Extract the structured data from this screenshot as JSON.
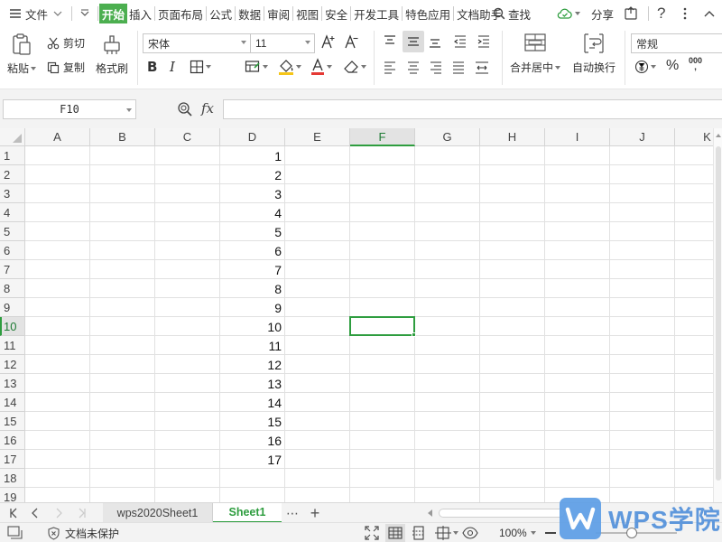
{
  "menubar": {
    "file_label": "文件",
    "tabs": [
      {
        "label": "开始",
        "active": true
      },
      {
        "label": "插入"
      },
      {
        "label": "页面布局"
      },
      {
        "label": "公式"
      },
      {
        "label": "数据"
      },
      {
        "label": "审阅"
      },
      {
        "label": "视图"
      },
      {
        "label": "安全"
      },
      {
        "label": "开发工具"
      },
      {
        "label": "特色应用"
      },
      {
        "label": "文档助手"
      }
    ],
    "search_label": "查找",
    "share_label": "分享"
  },
  "ribbon": {
    "paste_label": "粘贴",
    "cut_label": "剪切",
    "copy_label": "复制",
    "format_painter_label": "格式刷",
    "font_name": "宋体",
    "font_size": "11",
    "merge_center_label": "合并居中",
    "wrap_text_label": "自动换行",
    "number_format": "常规",
    "percent_symbol": "%",
    "thousands_symbol": "000"
  },
  "formula_bar": {
    "name_box": "F10",
    "fx_label": "fx",
    "formula": ""
  },
  "grid": {
    "columns": [
      "A",
      "B",
      "C",
      "D",
      "E",
      "F",
      "G",
      "H",
      "I",
      "J",
      "K"
    ],
    "rows": [
      "1",
      "2",
      "3",
      "4",
      "5",
      "6",
      "7",
      "8",
      "9",
      "10",
      "11",
      "12",
      "13",
      "14",
      "15",
      "16",
      "17",
      "18",
      "19"
    ],
    "selected_column": "F",
    "selected_row": "10",
    "column_d_values": [
      "1",
      "2",
      "3",
      "4",
      "5",
      "6",
      "7",
      "8",
      "9",
      "10",
      "11",
      "12",
      "13",
      "14",
      "15",
      "16",
      "17"
    ]
  },
  "sheets": {
    "tabs": [
      {
        "label": "wps2020Sheet1",
        "active": false
      },
      {
        "label": "Sheet1",
        "active": true
      }
    ],
    "more_label": "⋯",
    "add_label": "+"
  },
  "statusbar": {
    "protection_label": "文档未保护",
    "zoom": "100%"
  },
  "watermark": {
    "text": "WPS学院"
  },
  "colors": {
    "accent_green": "#2e9d3f",
    "active_tab_green": "#4caf50",
    "watermark_blue": "#4f8fda"
  }
}
